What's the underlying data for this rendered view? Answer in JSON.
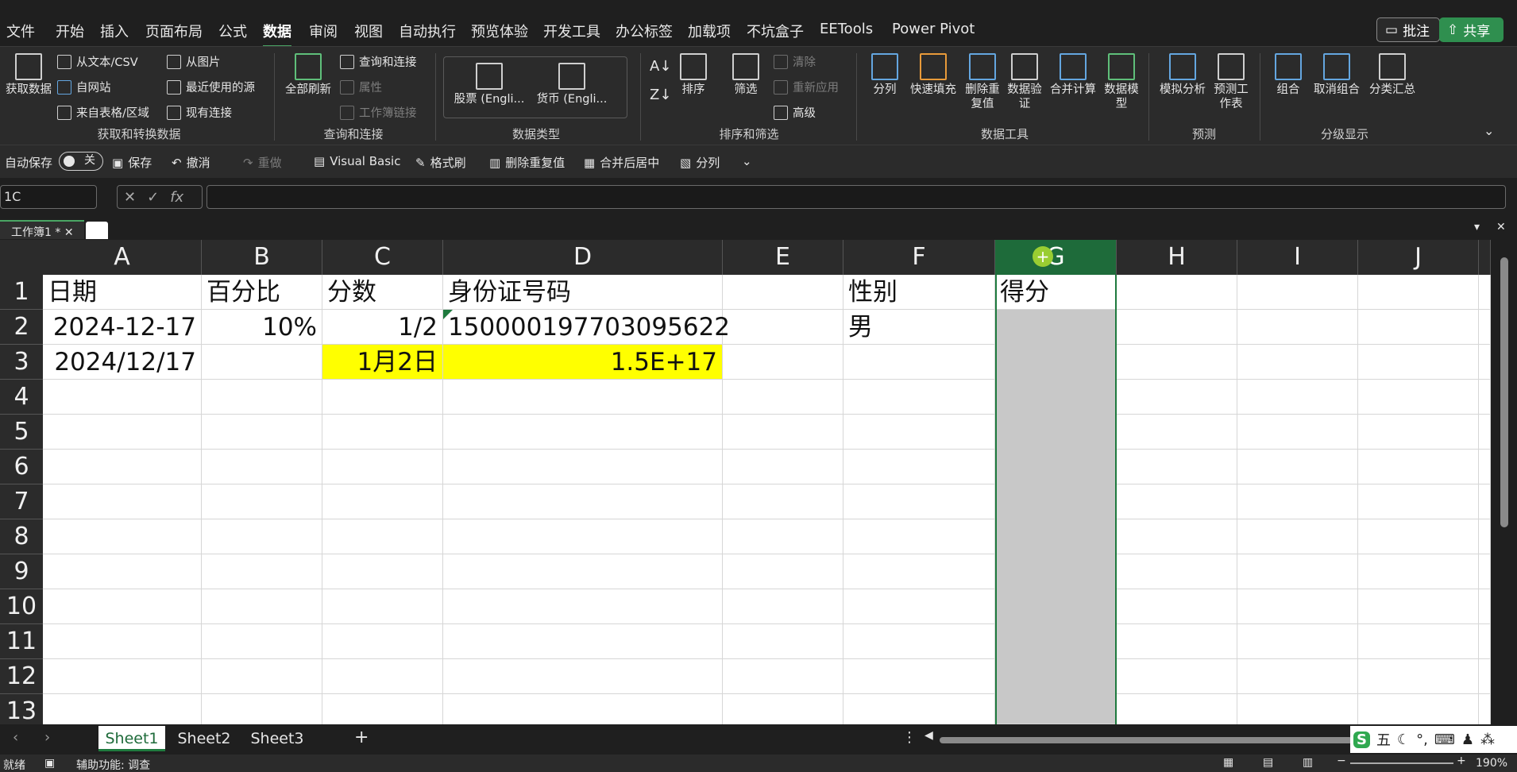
{
  "menu": {
    "tabs": [
      "文件",
      "开始",
      "插入",
      "页面布局",
      "公式",
      "数据",
      "审阅",
      "视图",
      "自动执行",
      "预览体验",
      "开发工具",
      "办公标签",
      "加载项",
      "不坑盒子",
      "EETools",
      "Power Pivot"
    ],
    "active": "数据",
    "comment": "批注",
    "share": "共享"
  },
  "ribbon": {
    "get_data": "获取数据",
    "from_text_csv": "从文本/CSV",
    "from_web": "自网站",
    "from_table": "来自表格/区域",
    "from_picture": "从图片",
    "recent_sources": "最近使用的源",
    "existing_connections": "现有连接",
    "group_get_transform": "获取和转换数据",
    "refresh_all": "全部刷新",
    "queries_connections": "查询和连接",
    "properties": "属性",
    "workbook_links": "工作簿链接",
    "group_queries": "查询和连接",
    "stocks": "股票 (Engli...",
    "currencies": "货币 (Engli...",
    "group_datatypes": "数据类型",
    "sort": "排序",
    "filter": "筛选",
    "clear": "清除",
    "reapply": "重新应用",
    "advanced": "高级",
    "group_sort_filter": "排序和筛选",
    "text_to_columns": "分列",
    "flash_fill": "快速填充",
    "remove_duplicates": "删除重复值",
    "data_validation": "数据验证",
    "consolidate": "合并计算",
    "data_model": "数据模型",
    "group_data_tools": "数据工具",
    "what_if": "模拟分析",
    "forecast_sheet": "预测工作表",
    "group_forecast": "预测",
    "group": "组合",
    "ungroup": "取消组合",
    "subtotal": "分类汇总",
    "group_outline": "分级显示"
  },
  "qat": {
    "autosave": "自动保存",
    "autosave_state": "关",
    "save": "保存",
    "undo": "撤消",
    "redo": "重做",
    "visual_basic": "Visual Basic",
    "format_painter": "格式刷",
    "remove_duplicates": "删除重复值",
    "merge_center": "合并后居中",
    "text_to_columns": "分列"
  },
  "formula_bar": {
    "name_box": "1C",
    "fx": "fx",
    "value": ""
  },
  "workbook_tab": "工作簿1 *",
  "sheet": {
    "columns": [
      "A",
      "B",
      "C",
      "D",
      "E",
      "F",
      "G",
      "H",
      "I",
      "J"
    ],
    "selected_column": "G",
    "rows": [
      "1",
      "2",
      "3",
      "4",
      "5",
      "6",
      "7",
      "8",
      "9",
      "10",
      "11",
      "12",
      "13"
    ],
    "cells": {
      "A1": "日期",
      "B1": "百分比",
      "C1": "分数",
      "D1": "身份证号码",
      "F1": "性别",
      "G1": "得分",
      "A2": "2024-12-17",
      "B2": "10%",
      "C2": "1/2",
      "D2": "150000197703095622",
      "F2": "男",
      "A3": "2024/12/17",
      "C3": "1月2日",
      "D3": "1.5E+17"
    },
    "highlight_color": "#ffff00",
    "selection_color": "#c8c8c8"
  },
  "sheet_tabs": [
    "Sheet1",
    "Sheet2",
    "Sheet3"
  ],
  "active_sheet": "Sheet1",
  "status": {
    "ready": "就绪",
    "accessibility": "辅助功能: 调查",
    "zoom": "190%",
    "ime": "五"
  }
}
